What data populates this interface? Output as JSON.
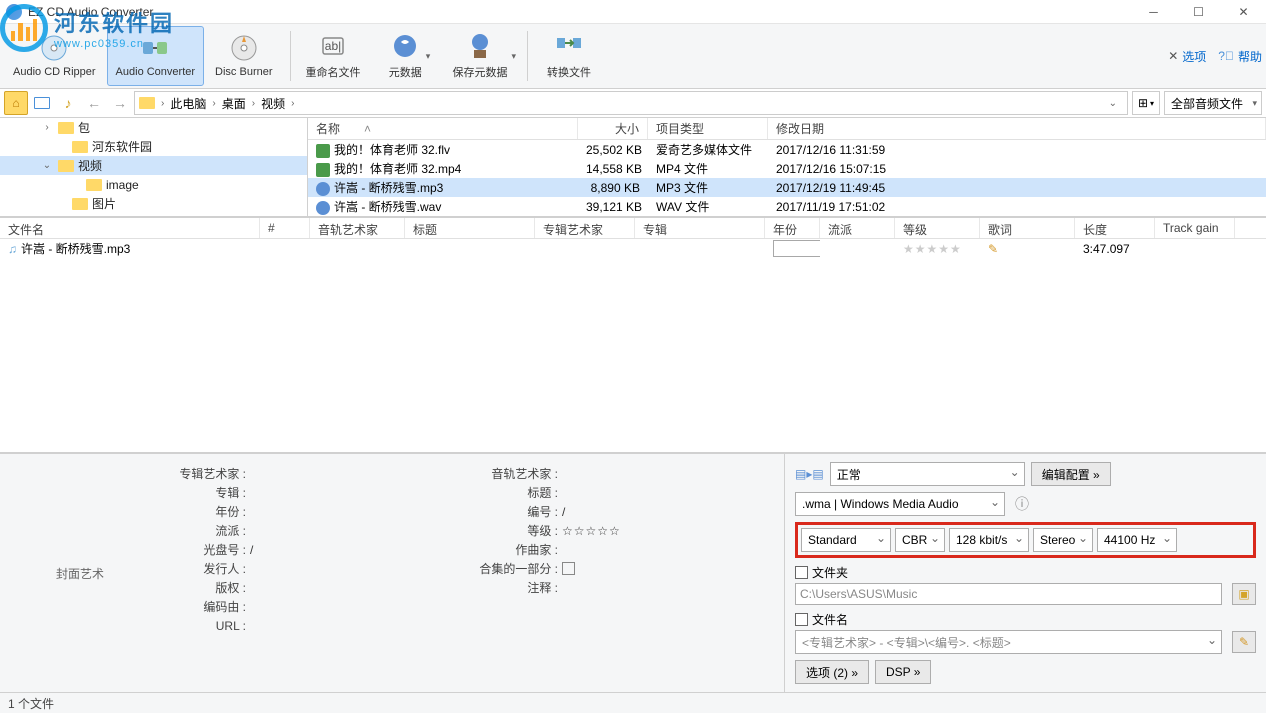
{
  "window": {
    "title": "EZ CD Audio Converter"
  },
  "watermark": {
    "cn": "河东软件园",
    "en": "www.pc0359.cn"
  },
  "topmenu": {
    "options": "选项",
    "help": "帮助"
  },
  "toolbar": {
    "ripper": "Audio CD Ripper",
    "converter": "Audio Converter",
    "burner": "Disc Burner",
    "rename": "重命名文件",
    "metadata": "元数据",
    "savemeta": "保存元数据",
    "convert": "转换文件"
  },
  "breadcrumb": {
    "segs": [
      "此电脑",
      "桌面",
      "视频"
    ],
    "filter": "全部音频文件"
  },
  "tree": [
    {
      "indent": 40,
      "toggle": "›",
      "label": "包"
    },
    {
      "indent": 54,
      "toggle": "",
      "label": "河东软件园"
    },
    {
      "indent": 40,
      "toggle": "⌄",
      "label": "视频",
      "sel": true
    },
    {
      "indent": 68,
      "toggle": "",
      "label": "image"
    },
    {
      "indent": 54,
      "toggle": "",
      "label": "图片"
    }
  ],
  "file_cols": {
    "name": "名称",
    "size": "大小",
    "type": "项目类型",
    "date": "修改日期"
  },
  "files": [
    {
      "icon": "video",
      "name": "我的！体育老师 32.flv",
      "size": "25,502 KB",
      "type": "爱奇艺多媒体文件",
      "date": "2017/12/16 11:31:59"
    },
    {
      "icon": "video",
      "name": "我的！体育老师 32.mp4",
      "size": "14,558 KB",
      "type": "MP4 文件",
      "date": "2017/12/16 15:07:15"
    },
    {
      "icon": "audio",
      "name": "许嵩 - 断桥残雪.mp3",
      "size": "8,890 KB",
      "type": "MP3 文件",
      "date": "2017/12/19 11:49:45",
      "sel": true
    },
    {
      "icon": "audio",
      "name": "许嵩 - 断桥残雪.wav",
      "size": "39,121 KB",
      "type": "WAV 文件",
      "date": "2017/11/19 17:51:02"
    }
  ],
  "queue_cols": [
    "文件名",
    "#",
    "音轨艺术家",
    "标题",
    "专辑艺术家",
    "专辑",
    "年份",
    "流派",
    "等级",
    "歌词",
    "长度",
    "Track gain"
  ],
  "queue": [
    {
      "name": "许嵩 - 断桥残雪.mp3",
      "length": "3:47.097"
    }
  ],
  "meta": {
    "cover": "封面艺术",
    "left_labels": [
      "专辑艺术家 :",
      "专辑 :",
      "年份 :",
      "流派 :",
      "光盘号 :",
      "发行人 :",
      "版权 :",
      "编码由 :",
      "URL :"
    ],
    "left_vals": [
      "",
      "",
      "",
      "",
      "/",
      "",
      "",
      "",
      ""
    ],
    "right_labels": [
      "音轨艺术家 :",
      "标题 :",
      "编号 :",
      "等级 :",
      "作曲家 :",
      "合集的一部分 :",
      "注释 :"
    ],
    "right_vals": [
      "",
      "",
      "/",
      "☆☆☆☆☆",
      "",
      "chk",
      ""
    ]
  },
  "settings": {
    "mode": "正常",
    "edit_cfg": "编辑配置 »",
    "format": ".wma | Windows Media Audio",
    "enc": [
      "Standard",
      "CBR",
      "128 kbit/s",
      "Stereo",
      "44100 Hz"
    ],
    "folder_label": "文件夹",
    "folder_path": "C:\\Users\\ASUS\\Music",
    "filename_label": "文件名",
    "filename_pattern": "<专辑艺术家> - <专辑>\\<编号>. <标题>",
    "opts_btn": "选项 (2) »",
    "dsp_btn": "DSP »"
  },
  "status": "1 个文件"
}
